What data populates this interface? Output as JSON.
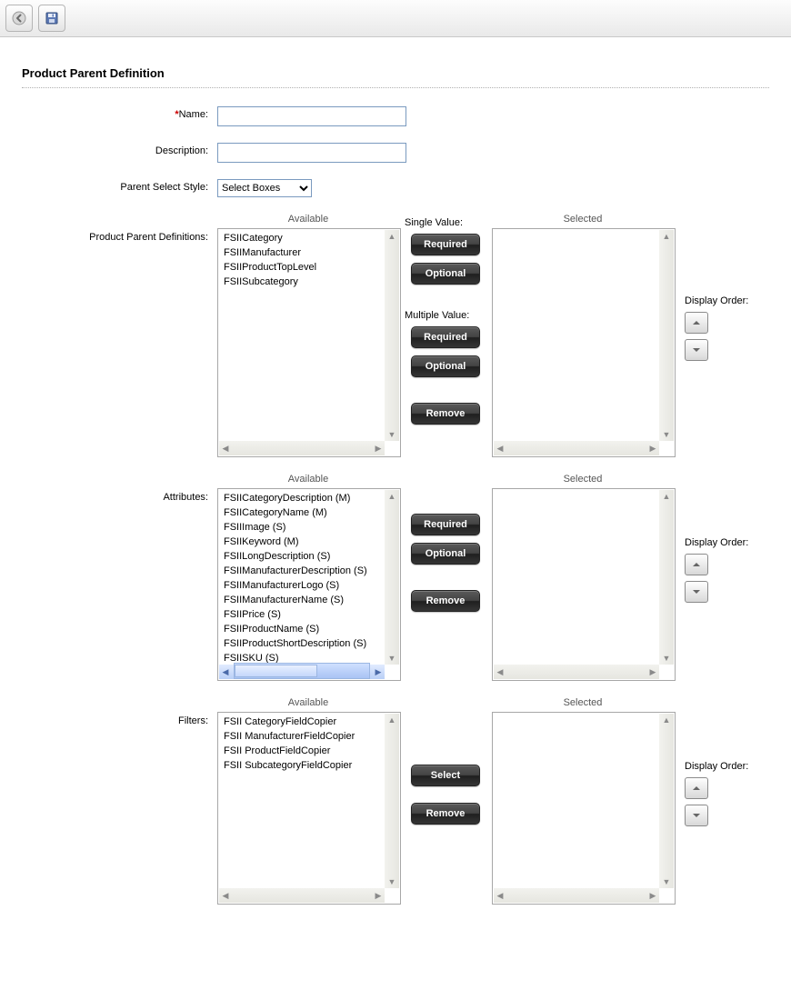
{
  "toolbar": {
    "back_icon": "back-icon",
    "save_icon": "save-icon"
  },
  "page_title": "Product Parent Definition",
  "labels": {
    "name": "Name:",
    "description": "Description:",
    "parent_select_style": "Parent Select Style:",
    "product_parent_definitions": "Product Parent Definitions:",
    "attributes": "Attributes:",
    "filters": "Filters:",
    "available": "Available",
    "selected": "Selected",
    "display_order": "Display Order:",
    "single_value": "Single Value:",
    "multiple_value": "Multiple Value:"
  },
  "buttons": {
    "required": "Required",
    "optional": "Optional",
    "remove": "Remove",
    "select": "Select"
  },
  "fields": {
    "name": "",
    "description": "",
    "parent_select_style": "Select Boxes"
  },
  "parent_select_style_options": [
    "Select Boxes"
  ],
  "ppd": {
    "available": [
      "FSIICategory",
      "FSIIManufacturer",
      "FSIIProductTopLevel",
      "FSIISubcategory"
    ],
    "selected": []
  },
  "attributes_list": {
    "available": [
      "FSIICategoryDescription (M)",
      "FSIICategoryName (M)",
      "FSIIImage (S)",
      "FSIIKeyword (M)",
      "FSIILongDescription (S)",
      "FSIIManufacturerDescription (S)",
      "FSIIManufacturerLogo (S)",
      "FSIIManufacturerName (S)",
      "FSIIPrice (S)",
      "FSIIProductName (S)",
      "FSIIProductShortDescription (S)",
      "FSIISKU (S)"
    ],
    "selected": []
  },
  "filters_list": {
    "available": [
      "FSII CategoryFieldCopier",
      "FSII ManufacturerFieldCopier",
      "FSII ProductFieldCopier",
      "FSII SubcategoryFieldCopier"
    ],
    "selected": []
  }
}
